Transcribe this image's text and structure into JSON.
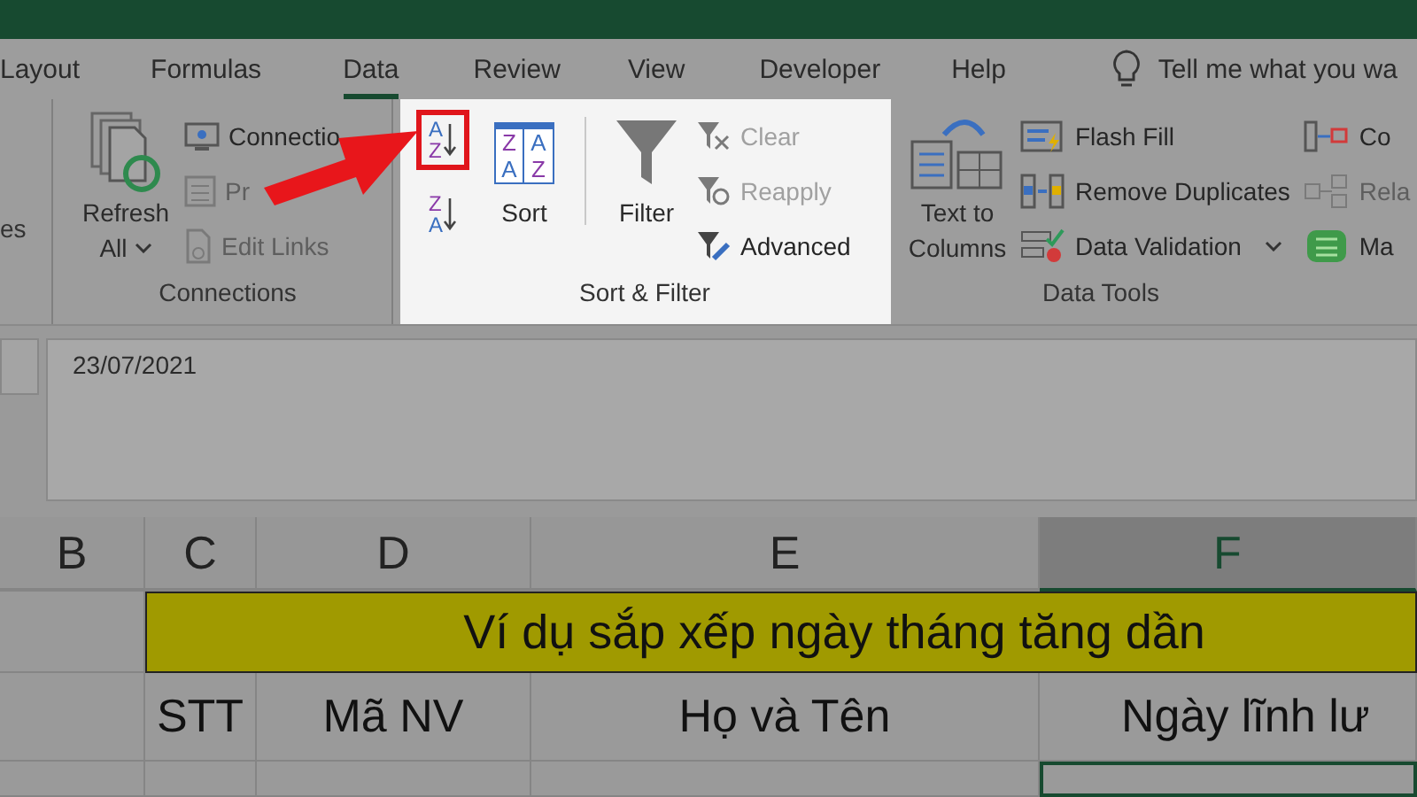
{
  "tabs": [
    {
      "label": "Layout",
      "selected": false
    },
    {
      "label": "Formulas",
      "selected": false
    },
    {
      "label": "Data",
      "selected": true
    },
    {
      "label": "Review",
      "selected": false
    },
    {
      "label": "View",
      "selected": false
    },
    {
      "label": "Developer",
      "selected": false
    },
    {
      "label": "Help",
      "selected": false
    }
  ],
  "tell_me": {
    "placeholder": "Tell me what you wa"
  },
  "ribbon": {
    "groups": [
      {
        "kind": "partial",
        "label": "es",
        "highlighted": false
      },
      {
        "kind": "connections",
        "label": "Connections",
        "highlighted": false,
        "large": [
          {
            "label": "Refresh",
            "sublabel": "All",
            "kind": "refresh"
          }
        ],
        "items": [
          {
            "label": "Connectio",
            "disabled": false,
            "kind": "connections"
          },
          {
            "label": "Pr",
            "disabled": true,
            "kind": "properties"
          },
          {
            "label": "Edit Links",
            "disabled": true,
            "kind": "links"
          }
        ]
      },
      {
        "kind": "sort",
        "label": "Sort & Filter",
        "highlighted": true,
        "sort_buttons": [
          {
            "kind": "asc",
            "top": "A",
            "bottom": "Z",
            "outlined": true
          },
          {
            "kind": "desc",
            "top": "Z",
            "bottom": "A",
            "outlined": false
          }
        ],
        "sort_large": {
          "label": "Sort",
          "glyphs": [
            "Z",
            "A",
            "A",
            "Z"
          ]
        },
        "filter": {
          "label": "Filter"
        },
        "items": [
          {
            "label": "Clear",
            "disabled": true,
            "kind": "clear"
          },
          {
            "label": "Reapply",
            "disabled": true,
            "kind": "reapply"
          },
          {
            "label": "Advanced",
            "disabled": false,
            "kind": "advanced"
          }
        ]
      },
      {
        "kind": "tools",
        "label": "Data Tools",
        "highlighted": false,
        "large": [
          {
            "label": "Text to",
            "sublabel": "Columns",
            "kind": "text-columns"
          }
        ],
        "items": [
          {
            "label": "Flash Fill",
            "disabled": false,
            "kind": "flash"
          },
          {
            "label": "Remove Duplicates",
            "disabled": false,
            "kind": "duplicates"
          },
          {
            "label": "Data Validation",
            "disabled": false,
            "kind": "validation",
            "dropdown": true
          }
        ],
        "items_2": [
          {
            "label": "Co",
            "disabled": false,
            "kind": "consolidate"
          },
          {
            "label": "Rela",
            "disabled": true,
            "kind": "relations"
          },
          {
            "label": "Ma",
            "disabled": false,
            "kind": "model"
          }
        ]
      }
    ]
  },
  "formula_bar": {
    "value": "23/07/2021"
  },
  "sheet": {
    "columns": [
      {
        "label": "B",
        "selected": false
      },
      {
        "label": "C",
        "selected": false
      },
      {
        "label": "D",
        "selected": false
      },
      {
        "label": "E",
        "selected": false
      },
      {
        "label": "F",
        "selected": true
      }
    ],
    "title": "Ví dụ sắp xếp ngày tháng tăng dần",
    "headers": [
      "STT",
      "Mã NV",
      "Họ và Tên",
      "Ngày lĩnh lư"
    ]
  }
}
